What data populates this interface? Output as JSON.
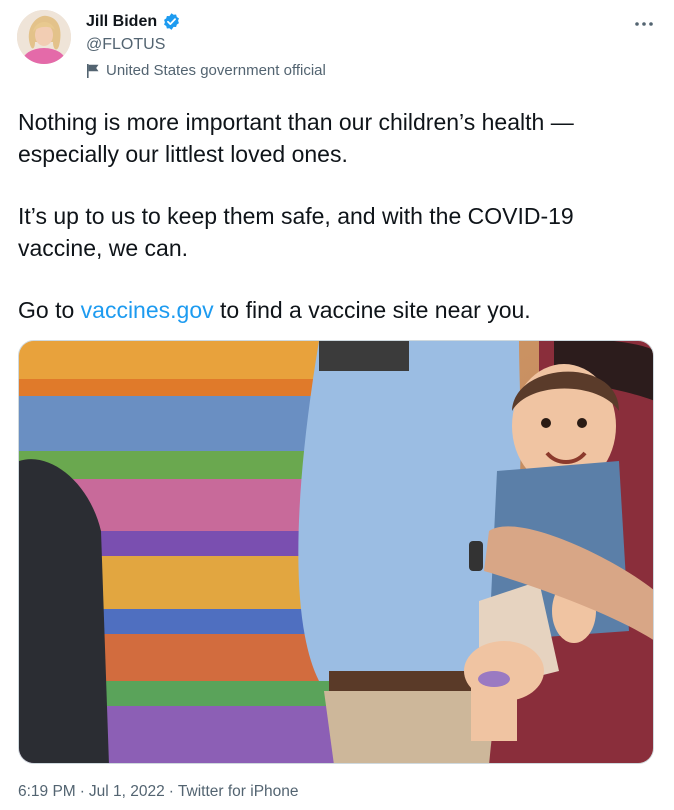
{
  "author": {
    "name": "Jill Biden",
    "handle": "@FLOTUS",
    "label": "United States government official"
  },
  "tweet": {
    "line1": "Nothing is more important than our children’s health — especially our littlest loved ones.",
    "line2": "It’s up to us to keep them safe, and with the COVID-19 vaccine, we can.",
    "line3_prefix": "Go to ",
    "line3_link": "vaccines.gov",
    "line3_suffix": " to find a vaccine site near you."
  },
  "meta": {
    "time": "6:19 PM",
    "sep1": "·",
    "date": "Jul 1, 2022",
    "sep2": "·",
    "source": "Twitter for iPhone"
  },
  "colors": {
    "link": "#1d9bf0",
    "secondary_text": "#536471",
    "verified": "#1d9bf0"
  },
  "icons": [
    "verified-badge-icon",
    "government-flag-icon",
    "more-options-icon"
  ]
}
